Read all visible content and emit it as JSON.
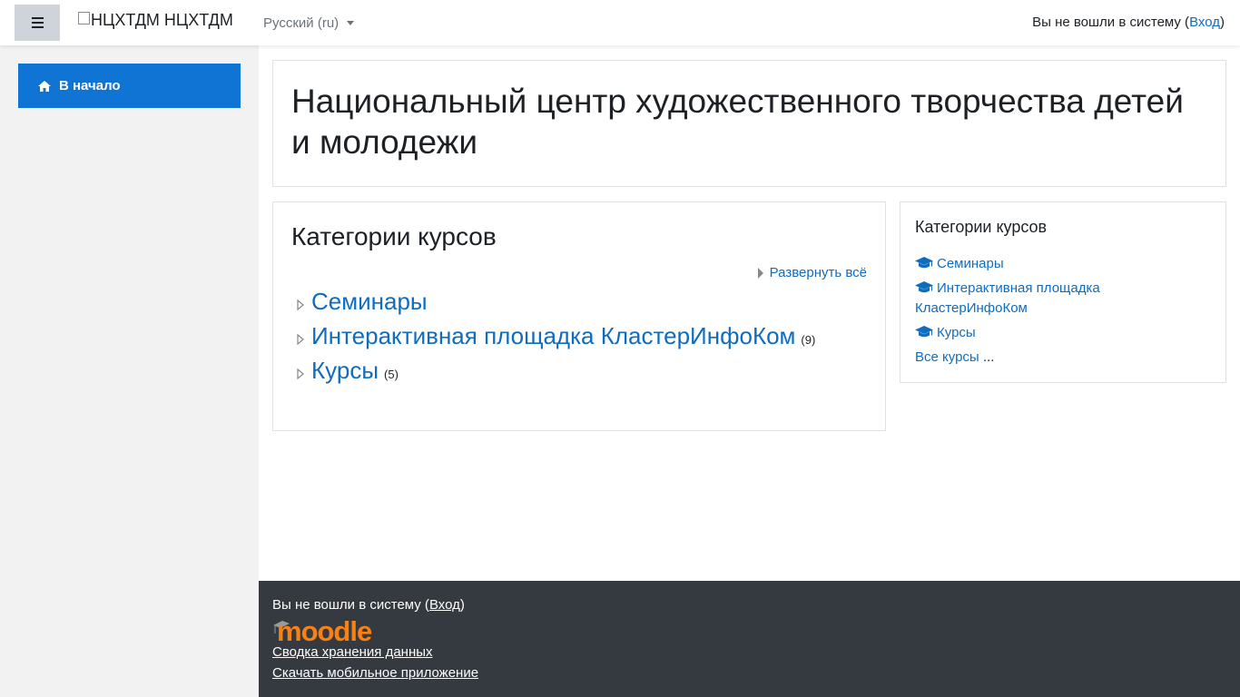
{
  "navbar": {
    "brand_alt": "НЦХТДМ",
    "brand_name": "НЦХТДМ",
    "language": "Русский (ru)",
    "login_prefix": "Вы не вошли в систему (",
    "login_link": "Вход",
    "login_suffix": ")"
  },
  "drawer": {
    "items": [
      {
        "label": "В начало"
      }
    ]
  },
  "header": {
    "title": "Национальный центр художественного творчества детей и молодежи"
  },
  "categories": {
    "title": "Категории курсов",
    "expand_all": "Развернуть всё",
    "items": [
      {
        "name": "Семинары",
        "count": ""
      },
      {
        "name": "Интерактивная площадка КластерИнфоКом",
        "count": "(9)"
      },
      {
        "name": "Курсы",
        "count": "(5)"
      }
    ]
  },
  "block": {
    "title": "Категории курсов",
    "items": [
      {
        "name": "Семинары"
      },
      {
        "name": "Интерактивная площадка КластерИнфоКом"
      },
      {
        "name": "Курсы"
      }
    ],
    "all_courses": "Все курсы",
    "ellipsis": " ..."
  },
  "footer": {
    "login_prefix": "Вы не вошли в систему (",
    "login_link": "Вход",
    "login_suffix": ")",
    "logo_text": "moodle",
    "policy": "Сводка хранения данных",
    "app": "Скачать мобильное приложение"
  },
  "colors": {
    "accent": "#0f74d4",
    "link": "#0f6cbf",
    "footer_bg": "#343a40",
    "moodle_orange": "#f98012"
  }
}
